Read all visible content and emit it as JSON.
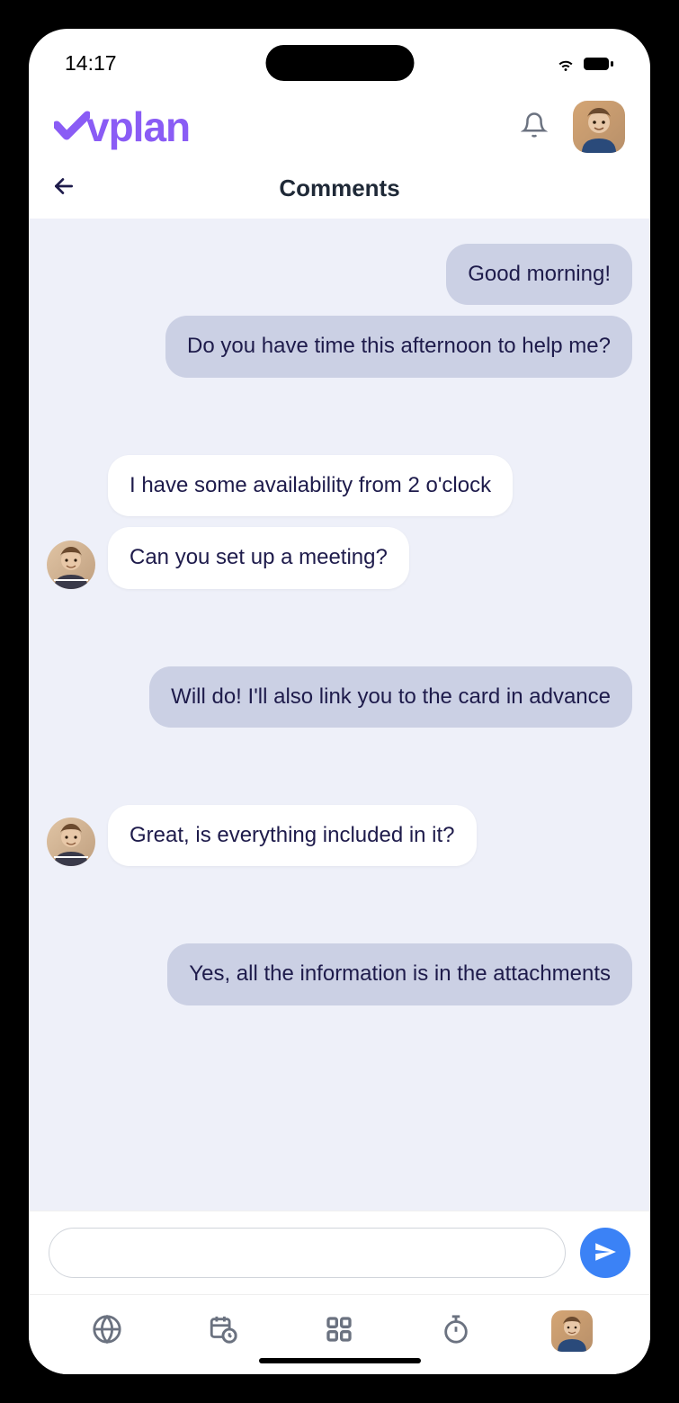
{
  "status": {
    "time": "14:17"
  },
  "brand": {
    "name": "vplan"
  },
  "header": {
    "title": "Comments"
  },
  "messages": [
    {
      "id": 0,
      "direction": "out",
      "text": "Good morning!",
      "showAvatar": false
    },
    {
      "id": 1,
      "direction": "out",
      "text": "Do you have time this afternoon to help me?",
      "showAvatar": false
    },
    {
      "id": 2,
      "direction": "in",
      "text": "I have some availability from 2 o'clock",
      "showAvatar": false
    },
    {
      "id": 3,
      "direction": "in",
      "text": "Can you set up a meeting?",
      "showAvatar": true
    },
    {
      "id": 4,
      "direction": "out",
      "text": "Will do! I'll also link you to the card in advance",
      "showAvatar": false
    },
    {
      "id": 5,
      "direction": "in",
      "text": "Great, is everything included in it?",
      "showAvatar": true
    },
    {
      "id": 6,
      "direction": "out",
      "text": "Yes, all the information is in the attachments",
      "showAvatar": false
    }
  ],
  "input": {
    "placeholder": ""
  },
  "nav": {
    "items": [
      "globe",
      "calendar",
      "grid",
      "timer",
      "profile"
    ]
  },
  "colors": {
    "brand": "#8a5cf5",
    "bubbleOut": "#cbd0e4",
    "bubbleIn": "#ffffff",
    "text": "#1e1b4b",
    "chatBg": "#eef0f9",
    "sendBtn": "#3b82f6"
  }
}
